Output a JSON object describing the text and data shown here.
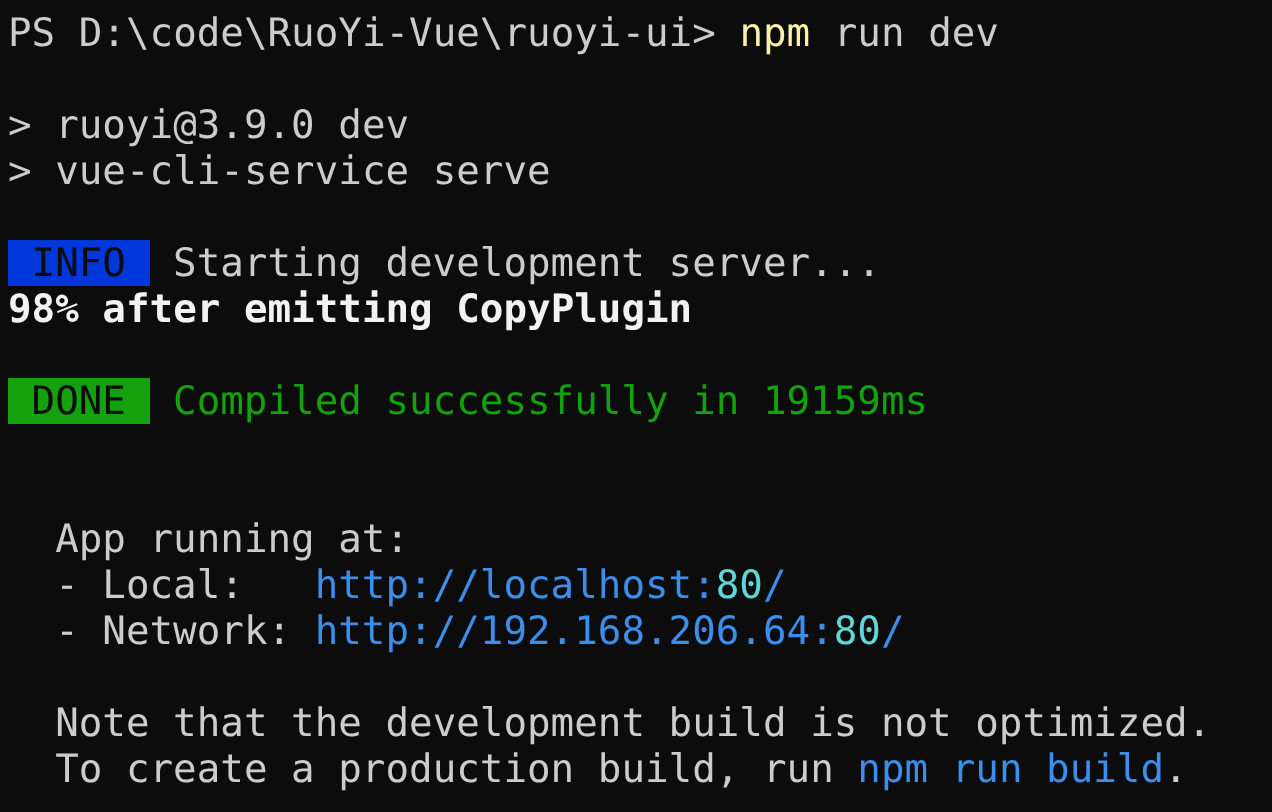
{
  "terminal": {
    "lines": [
      {
        "kind": "text",
        "indent": false,
        "segments": [
          {
            "kind": "plain",
            "text": "PS D:\\code\\RuoYi-Vue\\ruoyi-ui> "
          },
          {
            "kind": "command",
            "text": "npm"
          },
          {
            "kind": "plain",
            "text": " run dev"
          }
        ]
      },
      {
        "kind": "blank"
      },
      {
        "kind": "text",
        "indent": false,
        "segments": [
          {
            "kind": "plain",
            "text": "> ruoyi@3.9.0 dev"
          }
        ]
      },
      {
        "kind": "text",
        "indent": false,
        "segments": [
          {
            "kind": "plain",
            "text": "> vue-cli-service serve"
          }
        ]
      },
      {
        "kind": "blank"
      },
      {
        "kind": "text",
        "indent": false,
        "segments": [
          {
            "kind": "info-badge",
            "text": "INFO"
          },
          {
            "kind": "plain",
            "text": " Starting development server..."
          }
        ]
      },
      {
        "kind": "text",
        "indent": false,
        "segments": [
          {
            "kind": "bright",
            "text": "98% after emitting CopyPlugin"
          }
        ]
      },
      {
        "kind": "blank"
      },
      {
        "kind": "text",
        "indent": false,
        "segments": [
          {
            "kind": "done-badge",
            "text": "DONE"
          },
          {
            "kind": "success",
            "text": " Compiled successfully in 19159ms"
          }
        ]
      },
      {
        "kind": "blank"
      },
      {
        "kind": "blank"
      },
      {
        "kind": "text",
        "indent": true,
        "segments": [
          {
            "kind": "plain",
            "text": "App running at:"
          }
        ]
      },
      {
        "kind": "text",
        "indent": true,
        "segments": [
          {
            "kind": "plain",
            "text": "- Local:   "
          },
          {
            "kind": "url",
            "parts": [
              {
                "kind": "host",
                "text": "http://localhost:"
              },
              {
                "kind": "port",
                "text": "80"
              },
              {
                "kind": "host",
                "text": "/"
              }
            ]
          }
        ]
      },
      {
        "kind": "text",
        "indent": true,
        "segments": [
          {
            "kind": "plain",
            "text": "- Network: "
          },
          {
            "kind": "url",
            "parts": [
              {
                "kind": "host",
                "text": "http://192.168.206.64:"
              },
              {
                "kind": "port",
                "text": "80"
              },
              {
                "kind": "host",
                "text": "/"
              }
            ]
          }
        ]
      },
      {
        "kind": "blank"
      },
      {
        "kind": "text",
        "indent": true,
        "segments": [
          {
            "kind": "plain",
            "text": "Note that the development build is not optimized."
          }
        ]
      },
      {
        "kind": "text",
        "indent": true,
        "segments": [
          {
            "kind": "plain",
            "text": "To create a production build, run "
          },
          {
            "kind": "link-command",
            "text": "npm run build"
          },
          {
            "kind": "plain",
            "text": "."
          }
        ]
      }
    ]
  }
}
